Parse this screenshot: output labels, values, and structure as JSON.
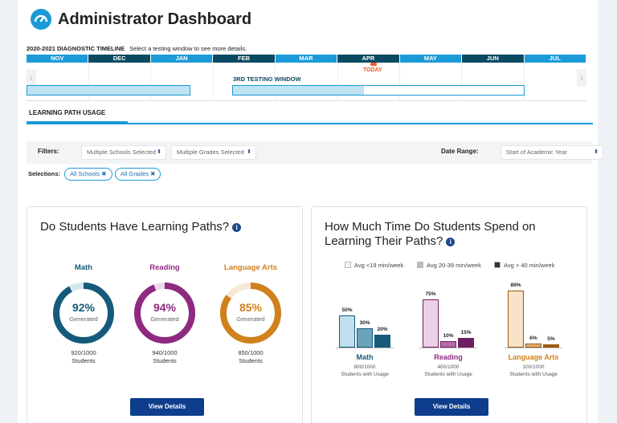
{
  "header": {
    "title": "Administrator Dashboard"
  },
  "timeline": {
    "label_bold": "2020-2021 DIAGNOSTIC TIMELINE",
    "label_hint": "Select a testing window to see more details.",
    "months": [
      "NOV",
      "DEC",
      "JAN",
      "FEB",
      "MAR",
      "APR",
      "MAY",
      "JUN",
      "JUL"
    ],
    "window_label": "3RD TESTING WINDOW",
    "window_progress": 0.45,
    "today_label": "TODAY"
  },
  "tabs": {
    "active": "LEARNING PATH USAGE"
  },
  "filters": {
    "label": "Filters:",
    "schools": "Multiple Schools Selected",
    "grades": "Multiple Grades Selected",
    "date_range_label": "Date Range:",
    "date_range": "Start of Academic Year"
  },
  "selections": {
    "label": "Selections:",
    "chips": [
      "All Schools",
      "All Grades"
    ]
  },
  "card1": {
    "title": "Do Students Have Learning Paths?",
    "subjects": [
      {
        "name": "Math",
        "pct_text": "92%",
        "pct": 92,
        "sub": "Generated",
        "count": "920/1000",
        "unit": "Students",
        "color": "#155a7a",
        "track": "#d6e6ee"
      },
      {
        "name": "Reading",
        "pct_text": "94%",
        "pct": 94,
        "sub": "Generated",
        "count": "940/1000",
        "unit": "Students",
        "color": "#8e2a7f",
        "track": "#eed9ea"
      },
      {
        "name": "Language Arts",
        "pct_text": "85%",
        "pct": 85,
        "sub": "Generated",
        "count": "850/1000",
        "unit": "Students",
        "color": "#d0811c",
        "track": "#f6e8d4"
      }
    ],
    "button": "View Details"
  },
  "card2": {
    "title_line1": "How Much Time Do Students Spend on",
    "title_line2": "Learning Their Paths?",
    "legend": [
      {
        "label": "Avg <19 min/week",
        "color": "#f2f2f2"
      },
      {
        "label": "Avg 20-39 min/week",
        "color": "#bdbdbd"
      },
      {
        "label": "Avg > 40 min/week",
        "color": "#333333"
      }
    ],
    "button": "View Details"
  },
  "chart_data": {
    "type": "bar",
    "categories": [
      "Math",
      "Reading",
      "Language Arts"
    ],
    "series": [
      {
        "name": "Avg <19 min/week",
        "values": [
          50,
          75,
          89
        ]
      },
      {
        "name": "Avg 20-39 min/week",
        "values": [
          30,
          10,
          6
        ]
      },
      {
        "name": "Avg > 40 min/week",
        "values": [
          20,
          15,
          5
        ]
      }
    ],
    "value_labels": [
      [
        "50%",
        "30%",
        "20%"
      ],
      [
        "75%",
        "10%",
        "15%"
      ],
      [
        "89%",
        "6%",
        "5%"
      ]
    ],
    "group_subtitles": [
      [
        "800/1000",
        "Students with Usage"
      ],
      [
        "400/1000",
        "Students with Usage"
      ],
      [
        "100/1000",
        "Students with Usage"
      ]
    ],
    "colors": [
      [
        "#bfe0ec",
        "#6aa3bb",
        "#155a7a"
      ],
      [
        "#ecd0e7",
        "#b56aa8",
        "#6e1f63"
      ],
      [
        "#f6e3c8",
        "#e1b070",
        "#9c5a10"
      ]
    ],
    "ylim": [
      0,
      100
    ]
  }
}
